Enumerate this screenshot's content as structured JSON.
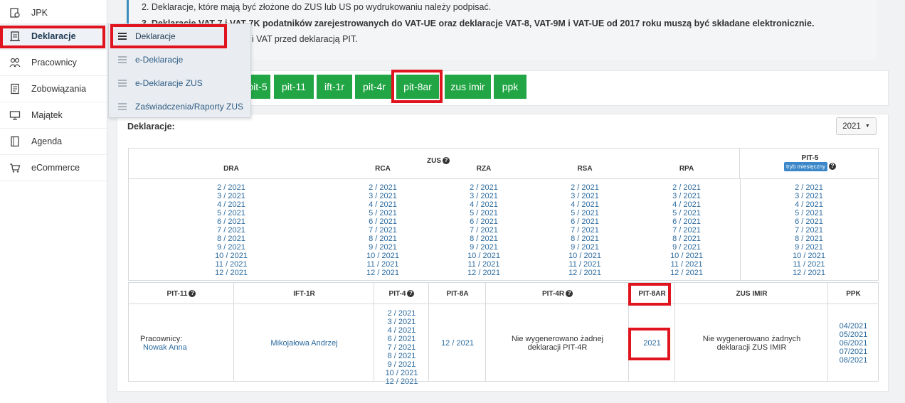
{
  "sidebar": {
    "items": [
      {
        "label": "JPK",
        "icon": "jpk-icon"
      },
      {
        "label": "Deklaracje",
        "icon": "declarations-icon"
      },
      {
        "label": "Pracownicy",
        "icon": "employees-icon"
      },
      {
        "label": "Zobowiązania",
        "icon": "liabilities-icon"
      },
      {
        "label": "Majątek",
        "icon": "assets-icon"
      },
      {
        "label": "Agenda",
        "icon": "agenda-icon"
      },
      {
        "label": "eCommerce",
        "icon": "cart-icon"
      }
    ]
  },
  "submenu": {
    "items": [
      "Deklaracje",
      "e-Deklaracje",
      "e-Deklaracje ZUS",
      "Zaświadczenia/Raporty ZUS"
    ]
  },
  "notice": {
    "line2": "2. Deklaracje, które mają być złożone do ZUS lub US po wydrukowaniu należy podpisać.",
    "line3": "3. Deklaracje VAT-7 i VAT-7K podatników zarejestrowanych do VAT-UE oraz deklaracje VAT-8, VAT-9M i VAT-UE od 2017 roku muszą być składane elektronicznie.",
    "line4": "4. Sporządź deklaracji ZUS i VAT przed deklaracją PIT."
  },
  "buttons": [
    "pit-5",
    "pit-11",
    "ift-1r",
    "pit-4r",
    "pit-8ar",
    "zus imir",
    "ppk"
  ],
  "panel": {
    "title": "Deklaracje:",
    "year": "2021"
  },
  "zus": {
    "group_label": "ZUS",
    "columns": [
      "DRA",
      "RCA",
      "RZA",
      "RSA",
      "RPA"
    ],
    "periods": [
      "2 / 2021",
      "3 / 2021",
      "4 / 2021",
      "5 / 2021",
      "6 / 2021",
      "7 / 2021",
      "8 / 2021",
      "9 / 2021",
      "10 / 2021",
      "11 / 2021",
      "12 / 2021"
    ]
  },
  "pit5": {
    "label": "PIT-5",
    "badge": "tryb miesięczny"
  },
  "bottom": {
    "headers": [
      "PIT-11",
      "IFT-1R",
      "PIT-4",
      "PIT-8A",
      "PIT-4R",
      "PIT-8AR",
      "ZUS IMIR",
      "PPK"
    ],
    "pit11_label": "Pracownicy:",
    "pit11_name": "Nowak Anna",
    "ift1r_name": "Mikojałowa Andrzej",
    "pit4_periods": [
      "2 / 2021",
      "3 / 2021",
      "4 / 2021",
      "6 / 2021",
      "7 / 2021",
      "8 / 2021",
      "9 / 2021",
      "10 / 2021",
      "12 / 2021"
    ],
    "pit8a_period": "12 / 2021",
    "pit4r_msg_1": "Nie wygenerowano żadnej",
    "pit4r_msg_2": "deklaracji PIT-4R",
    "pit8ar_year": "2021",
    "zusimir_msg_1": "Nie wygenerowano żadnych",
    "zusimir_msg_2": "deklaracji ZUS IMIR",
    "ppk_periods": [
      "04/2021",
      "05/2021",
      "06/2021",
      "07/2021",
      "08/2021"
    ]
  },
  "colors": {
    "green": "#22a645",
    "highlight": "#e0141e",
    "link": "#2a6a9f",
    "accent": "#3c8dbc"
  }
}
